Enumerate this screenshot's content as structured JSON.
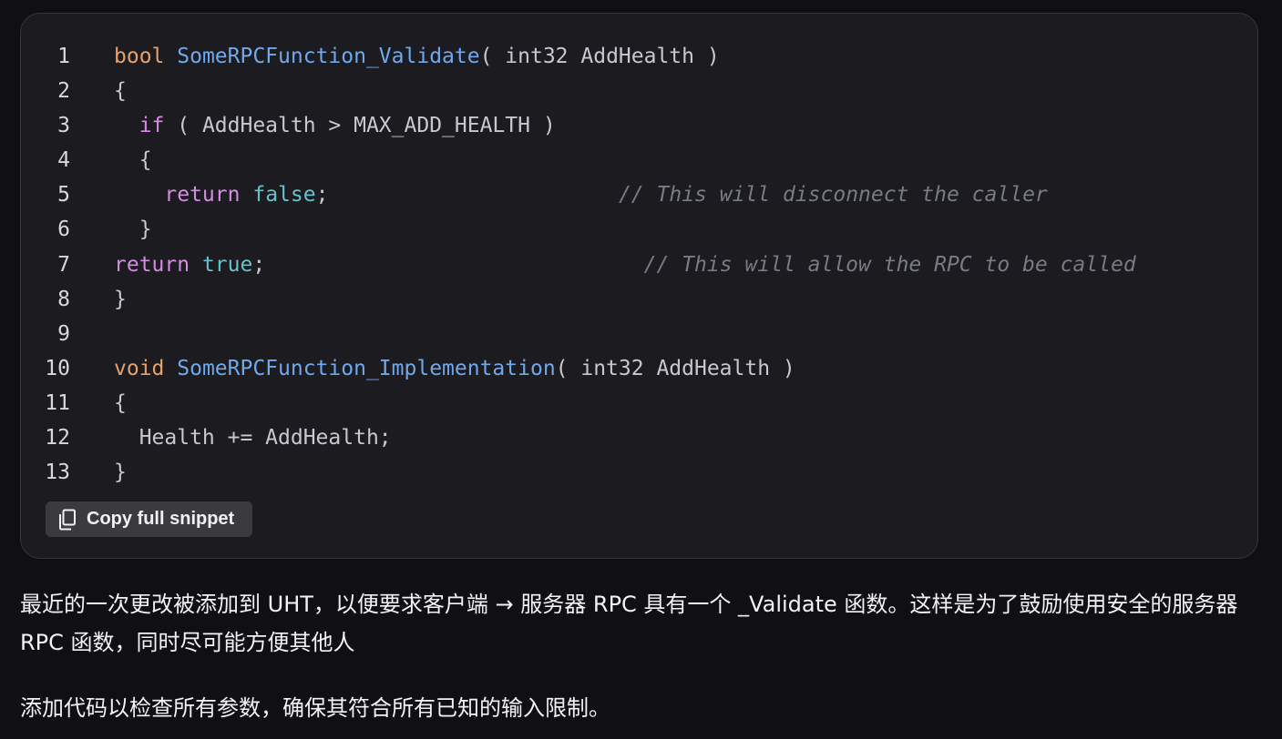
{
  "code_block": {
    "lines": [
      {
        "num": "1",
        "tokens": [
          {
            "t": "bool",
            "c": "kw"
          },
          {
            "t": " ",
            "c": "plain"
          },
          {
            "t": "SomeRPCFunction_Validate",
            "c": "fn"
          },
          {
            "t": "( int32 AddHealth )",
            "c": "plain"
          }
        ]
      },
      {
        "num": "2",
        "tokens": [
          {
            "t": "{",
            "c": "plain"
          }
        ]
      },
      {
        "num": "3",
        "tokens": [
          {
            "t": "  ",
            "c": "plain"
          },
          {
            "t": "if",
            "c": "ctrl"
          },
          {
            "t": " ( AddHealth > MAX_ADD_HEALTH )",
            "c": "plain"
          }
        ]
      },
      {
        "num": "4",
        "tokens": [
          {
            "t": "  {",
            "c": "plain"
          }
        ]
      },
      {
        "num": "5",
        "tokens": [
          {
            "t": "    ",
            "c": "plain"
          },
          {
            "t": "return",
            "c": "ctrl"
          },
          {
            "t": " ",
            "c": "plain"
          },
          {
            "t": "false",
            "c": "lit"
          },
          {
            "t": ";",
            "c": "plain"
          },
          {
            "t": "                       ",
            "c": "plain"
          },
          {
            "t": "// This will disconnect the caller",
            "c": "comment"
          }
        ]
      },
      {
        "num": "6",
        "tokens": [
          {
            "t": "  }",
            "c": "plain"
          }
        ]
      },
      {
        "num": "7",
        "tokens": [
          {
            "t": "return",
            "c": "ctrl"
          },
          {
            "t": " ",
            "c": "plain"
          },
          {
            "t": "true",
            "c": "lit"
          },
          {
            "t": ";",
            "c": "plain"
          },
          {
            "t": "                              ",
            "c": "plain"
          },
          {
            "t": "// This will allow the RPC to be called",
            "c": "comment"
          }
        ]
      },
      {
        "num": "8",
        "tokens": [
          {
            "t": "}",
            "c": "plain"
          }
        ]
      },
      {
        "num": "9",
        "tokens": []
      },
      {
        "num": "10",
        "tokens": [
          {
            "t": "void",
            "c": "kw"
          },
          {
            "t": " ",
            "c": "plain"
          },
          {
            "t": "SomeRPCFunction_Implementation",
            "c": "fn"
          },
          {
            "t": "( int32 AddHealth )",
            "c": "plain"
          }
        ]
      },
      {
        "num": "11",
        "tokens": [
          {
            "t": "{",
            "c": "plain"
          }
        ]
      },
      {
        "num": "12",
        "tokens": [
          {
            "t": "  Health += AddHealth;",
            "c": "plain"
          }
        ]
      },
      {
        "num": "13",
        "tokens": [
          {
            "t": "}",
            "c": "plain"
          }
        ]
      }
    ],
    "copy_label": "Copy full snippet"
  },
  "prose": {
    "paragraph1": "最近的一次更改被添加到 UHT，以便要求客户端 → 服务器 RPC 具有一个 _Validate 函数。这样是为了鼓励使用安全的服务器 RPC 函数，同时尽可能方便其他人",
    "paragraph2": "添加代码以检查所有参数，确保其符合所有已知的输入限制。"
  },
  "colors": {
    "background": "#101014",
    "card": "#1b1b20",
    "keyword": "#e5a26c",
    "function": "#70a9eb",
    "control": "#d58ce0",
    "literal": "#67c1cc",
    "comment": "#777b84"
  }
}
